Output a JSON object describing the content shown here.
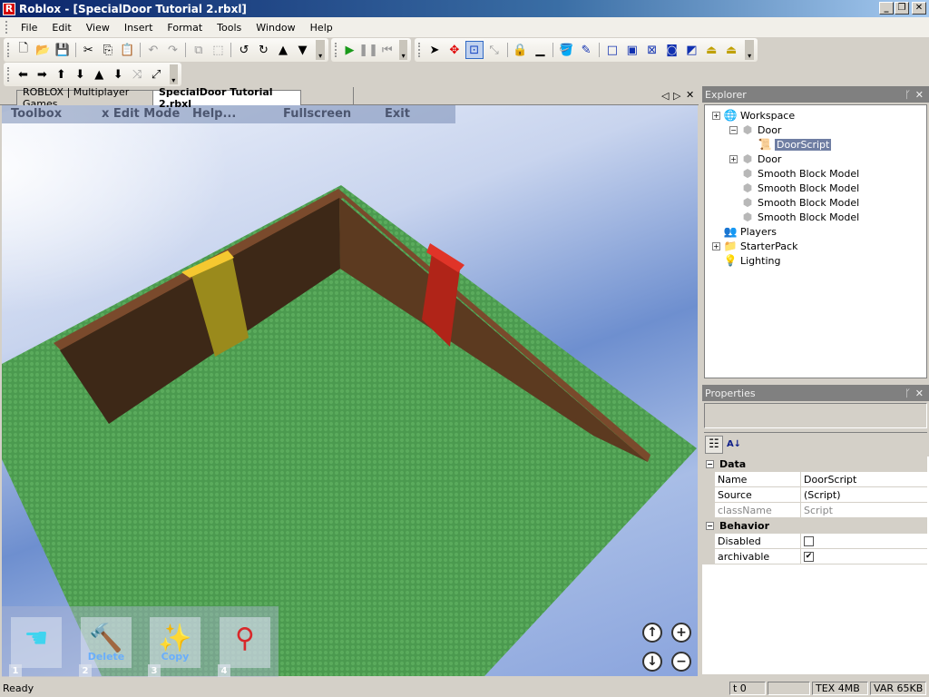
{
  "window": {
    "title": "Roblox - [SpecialDoor Tutorial 2.rbxl]",
    "logo_letter": "R",
    "minimize": "_",
    "restore": "❐",
    "close": "✕"
  },
  "menu": [
    "File",
    "Edit",
    "View",
    "Insert",
    "Format",
    "Tools",
    "Window",
    "Help"
  ],
  "toolbar1": [
    {
      "name": "new-icon",
      "glyph": "🗋"
    },
    {
      "name": "open-icon",
      "glyph": "📂"
    },
    {
      "name": "save-icon",
      "glyph": "💾"
    },
    {
      "name": "cut-icon",
      "glyph": "✂"
    },
    {
      "name": "copy-icon",
      "glyph": "⎘"
    },
    {
      "name": "paste-icon",
      "glyph": "📋"
    },
    {
      "name": "undo-icon",
      "glyph": "↶",
      "disabled": true
    },
    {
      "name": "redo-icon",
      "glyph": "↷",
      "disabled": true
    },
    {
      "name": "group-icon",
      "glyph": "⧉",
      "disabled": true
    },
    {
      "name": "ungroup-icon",
      "glyph": "⬚",
      "disabled": true
    },
    {
      "name": "rotate-icon",
      "glyph": "↺"
    },
    {
      "name": "tilt-icon",
      "glyph": "↻"
    },
    {
      "name": "lift-up-icon",
      "glyph": "▲"
    },
    {
      "name": "drop-down-icon",
      "glyph": "▼"
    }
  ],
  "toolbar_run": [
    {
      "name": "run-icon",
      "glyph": "▶",
      "color": "#1a9a1a"
    },
    {
      "name": "pause-icon",
      "glyph": "❚❚",
      "disabled": true
    },
    {
      "name": "reset-icon",
      "glyph": "⏮",
      "disabled": true
    }
  ],
  "toolbar_edit": [
    {
      "name": "select-icon",
      "glyph": "➤"
    },
    {
      "name": "move-icon",
      "glyph": "✥",
      "color": "#e00000"
    },
    {
      "name": "resize-icon",
      "glyph": "⊡",
      "color": "#1040c0",
      "selected": true
    },
    {
      "name": "joint-icon",
      "glyph": "⤡",
      "disabled": true
    },
    {
      "name": "lock-icon",
      "glyph": "🔒",
      "color": "#2030a0"
    },
    {
      "name": "anchor-icon",
      "glyph": "▁"
    },
    {
      "name": "paint-bucket-icon",
      "glyph": "🪣"
    },
    {
      "name": "dropper-icon",
      "glyph": "✎",
      "color": "#1030b0"
    },
    {
      "name": "surface-smooth-icon",
      "glyph": "□",
      "color": "#1030b0"
    },
    {
      "name": "surface-glue-icon",
      "glyph": "▣",
      "color": "#1030b0"
    },
    {
      "name": "surface-weld-icon",
      "glyph": "⊠",
      "color": "#1030b0"
    },
    {
      "name": "surface-studs-icon",
      "glyph": "◙",
      "color": "#1030b0"
    },
    {
      "name": "surface-inlet-icon",
      "glyph": "◩",
      "color": "#1030b0"
    },
    {
      "name": "surface-hinge-icon",
      "glyph": "⏏",
      "color": "#c0a000"
    },
    {
      "name": "surface-motor-icon",
      "glyph": "⏏",
      "color": "#c0a000"
    }
  ],
  "toolbar2": [
    {
      "name": "rotate-left-icon",
      "glyph": "⬅"
    },
    {
      "name": "rotate-right-icon",
      "glyph": "➡"
    },
    {
      "name": "tilt-up-icon",
      "glyph": "⬆"
    },
    {
      "name": "tilt-down-icon",
      "glyph": "⬇"
    },
    {
      "name": "move-up-icon",
      "glyph": "▲"
    },
    {
      "name": "move-down-icon",
      "glyph": "⬇"
    },
    {
      "name": "collapse-icon",
      "glyph": "⤨",
      "disabled": true
    },
    {
      "name": "expand-icon",
      "glyph": "⤢"
    }
  ],
  "tabs": [
    {
      "label": "ROBLOX | Multiplayer Games",
      "active": false
    },
    {
      "label": "SpecialDoor Tutorial 2.rbxl",
      "active": true
    }
  ],
  "tab_controls": {
    "prev": "◁",
    "next": "▷",
    "close": "✕"
  },
  "game_menu": [
    "Toolbox",
    "x Edit Mode",
    "Help...",
    "Fullscreen",
    "Exit"
  ],
  "tools": [
    {
      "num": "1",
      "label": "",
      "icon": "grab-hand-icon",
      "glyph": "☚"
    },
    {
      "num": "2",
      "label": "Delete",
      "icon": "hammer-icon",
      "glyph": "🔨"
    },
    {
      "num": "3",
      "label": "Copy",
      "icon": "magic-wand-icon",
      "glyph": "✨"
    },
    {
      "num": "4",
      "label": "",
      "icon": "slingshot-icon",
      "glyph": "⚲"
    }
  ],
  "camera": {
    "up": "↑",
    "down": "↓",
    "zoom_in": "+",
    "zoom_out": "−"
  },
  "scene": {
    "baseplate_color": "#4b9a4f",
    "wall_dark": "#3d2817",
    "wall_light": "#5c3a20",
    "wall_top": "#7a4a2c",
    "door_yellow": "#9a8a1c",
    "door_yellow_top": "#f5c830",
    "door_red": "#b02418",
    "door_red_top": "#e03428"
  },
  "explorer": {
    "title": "Explorer",
    "pin": "ᚴ",
    "close": "✕",
    "nodes": [
      {
        "label": "Workspace",
        "icon": "globe-icon",
        "glyph": "🌐",
        "expander": "+",
        "level": 0
      },
      {
        "label": "Door",
        "icon": "model-icon",
        "glyph": "⬢",
        "expander": "−",
        "level": 1
      },
      {
        "label": "DoorScript",
        "icon": "script-icon",
        "glyph": "📜",
        "expander": "",
        "level": 2,
        "selected": true
      },
      {
        "label": "Door",
        "icon": "model-icon",
        "glyph": "⬢",
        "expander": "+",
        "level": 1
      },
      {
        "label": "Smooth Block Model",
        "icon": "model-icon",
        "glyph": "⬢",
        "expander": "",
        "level": 1
      },
      {
        "label": "Smooth Block Model",
        "icon": "model-icon",
        "glyph": "⬢",
        "expander": "",
        "level": 1
      },
      {
        "label": "Smooth Block Model",
        "icon": "model-icon",
        "glyph": "⬢",
        "expander": "",
        "level": 1
      },
      {
        "label": "Smooth Block Model",
        "icon": "model-icon",
        "glyph": "⬢",
        "expander": "",
        "level": 1
      },
      {
        "label": "Players",
        "icon": "players-icon",
        "glyph": "👥",
        "expander": "",
        "level": 0
      },
      {
        "label": "StarterPack",
        "icon": "starterpack-icon",
        "glyph": "📁",
        "expander": "+",
        "level": 0
      },
      {
        "label": "Lighting",
        "icon": "lightbulb-icon",
        "glyph": "💡",
        "expander": "",
        "level": 0
      }
    ]
  },
  "properties": {
    "title": "Properties",
    "pin": "ᚴ",
    "close": "✕",
    "sort_categorized": "☷",
    "sort_alpha": "A↓",
    "categories": [
      {
        "name": "Data",
        "expander": "−",
        "rows": [
          {
            "name": "Name",
            "value": "DoorScript"
          },
          {
            "name": "Source",
            "value": "(Script)"
          },
          {
            "name": "className",
            "value": "Script",
            "readonly": true
          }
        ]
      },
      {
        "name": "Behavior",
        "expander": "−",
        "rows": [
          {
            "name": "Disabled",
            "checkbox": true,
            "checked": false
          },
          {
            "name": "archivable",
            "checkbox": true,
            "checked": true
          }
        ]
      }
    ]
  },
  "status": {
    "left": "Ready",
    "t": "t 0",
    "blank": "",
    "tex": "TEX 4MB",
    "var": "VAR 65KB"
  }
}
